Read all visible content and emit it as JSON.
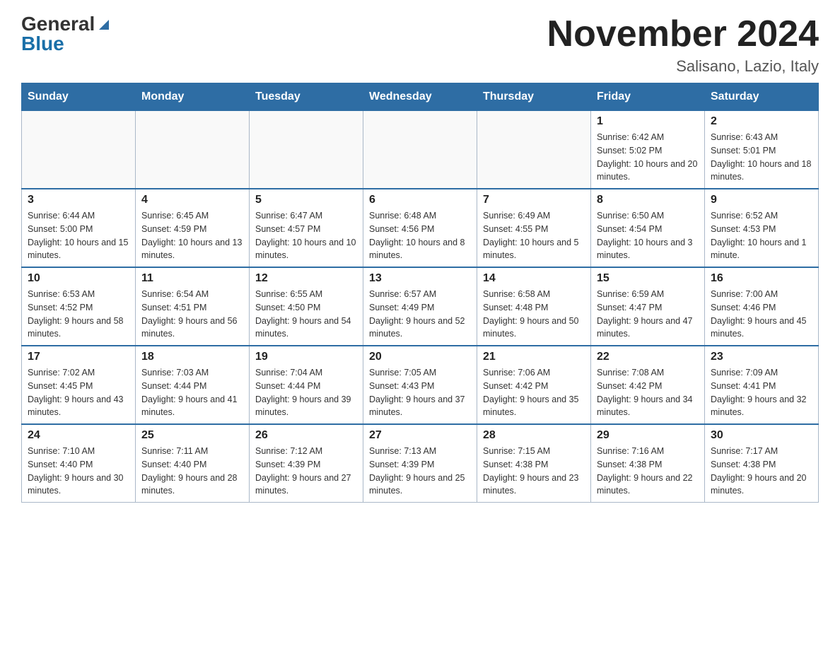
{
  "header": {
    "logo_general": "General",
    "logo_blue": "Blue",
    "month_title": "November 2024",
    "location": "Salisano, Lazio, Italy"
  },
  "days_of_week": [
    "Sunday",
    "Monday",
    "Tuesday",
    "Wednesday",
    "Thursday",
    "Friday",
    "Saturday"
  ],
  "weeks": [
    [
      {
        "day": "",
        "info": ""
      },
      {
        "day": "",
        "info": ""
      },
      {
        "day": "",
        "info": ""
      },
      {
        "day": "",
        "info": ""
      },
      {
        "day": "",
        "info": ""
      },
      {
        "day": "1",
        "info": "Sunrise: 6:42 AM\nSunset: 5:02 PM\nDaylight: 10 hours and 20 minutes."
      },
      {
        "day": "2",
        "info": "Sunrise: 6:43 AM\nSunset: 5:01 PM\nDaylight: 10 hours and 18 minutes."
      }
    ],
    [
      {
        "day": "3",
        "info": "Sunrise: 6:44 AM\nSunset: 5:00 PM\nDaylight: 10 hours and 15 minutes."
      },
      {
        "day": "4",
        "info": "Sunrise: 6:45 AM\nSunset: 4:59 PM\nDaylight: 10 hours and 13 minutes."
      },
      {
        "day": "5",
        "info": "Sunrise: 6:47 AM\nSunset: 4:57 PM\nDaylight: 10 hours and 10 minutes."
      },
      {
        "day": "6",
        "info": "Sunrise: 6:48 AM\nSunset: 4:56 PM\nDaylight: 10 hours and 8 minutes."
      },
      {
        "day": "7",
        "info": "Sunrise: 6:49 AM\nSunset: 4:55 PM\nDaylight: 10 hours and 5 minutes."
      },
      {
        "day": "8",
        "info": "Sunrise: 6:50 AM\nSunset: 4:54 PM\nDaylight: 10 hours and 3 minutes."
      },
      {
        "day": "9",
        "info": "Sunrise: 6:52 AM\nSunset: 4:53 PM\nDaylight: 10 hours and 1 minute."
      }
    ],
    [
      {
        "day": "10",
        "info": "Sunrise: 6:53 AM\nSunset: 4:52 PM\nDaylight: 9 hours and 58 minutes."
      },
      {
        "day": "11",
        "info": "Sunrise: 6:54 AM\nSunset: 4:51 PM\nDaylight: 9 hours and 56 minutes."
      },
      {
        "day": "12",
        "info": "Sunrise: 6:55 AM\nSunset: 4:50 PM\nDaylight: 9 hours and 54 minutes."
      },
      {
        "day": "13",
        "info": "Sunrise: 6:57 AM\nSunset: 4:49 PM\nDaylight: 9 hours and 52 minutes."
      },
      {
        "day": "14",
        "info": "Sunrise: 6:58 AM\nSunset: 4:48 PM\nDaylight: 9 hours and 50 minutes."
      },
      {
        "day": "15",
        "info": "Sunrise: 6:59 AM\nSunset: 4:47 PM\nDaylight: 9 hours and 47 minutes."
      },
      {
        "day": "16",
        "info": "Sunrise: 7:00 AM\nSunset: 4:46 PM\nDaylight: 9 hours and 45 minutes."
      }
    ],
    [
      {
        "day": "17",
        "info": "Sunrise: 7:02 AM\nSunset: 4:45 PM\nDaylight: 9 hours and 43 minutes."
      },
      {
        "day": "18",
        "info": "Sunrise: 7:03 AM\nSunset: 4:44 PM\nDaylight: 9 hours and 41 minutes."
      },
      {
        "day": "19",
        "info": "Sunrise: 7:04 AM\nSunset: 4:44 PM\nDaylight: 9 hours and 39 minutes."
      },
      {
        "day": "20",
        "info": "Sunrise: 7:05 AM\nSunset: 4:43 PM\nDaylight: 9 hours and 37 minutes."
      },
      {
        "day": "21",
        "info": "Sunrise: 7:06 AM\nSunset: 4:42 PM\nDaylight: 9 hours and 35 minutes."
      },
      {
        "day": "22",
        "info": "Sunrise: 7:08 AM\nSunset: 4:42 PM\nDaylight: 9 hours and 34 minutes."
      },
      {
        "day": "23",
        "info": "Sunrise: 7:09 AM\nSunset: 4:41 PM\nDaylight: 9 hours and 32 minutes."
      }
    ],
    [
      {
        "day": "24",
        "info": "Sunrise: 7:10 AM\nSunset: 4:40 PM\nDaylight: 9 hours and 30 minutes."
      },
      {
        "day": "25",
        "info": "Sunrise: 7:11 AM\nSunset: 4:40 PM\nDaylight: 9 hours and 28 minutes."
      },
      {
        "day": "26",
        "info": "Sunrise: 7:12 AM\nSunset: 4:39 PM\nDaylight: 9 hours and 27 minutes."
      },
      {
        "day": "27",
        "info": "Sunrise: 7:13 AM\nSunset: 4:39 PM\nDaylight: 9 hours and 25 minutes."
      },
      {
        "day": "28",
        "info": "Sunrise: 7:15 AM\nSunset: 4:38 PM\nDaylight: 9 hours and 23 minutes."
      },
      {
        "day": "29",
        "info": "Sunrise: 7:16 AM\nSunset: 4:38 PM\nDaylight: 9 hours and 22 minutes."
      },
      {
        "day": "30",
        "info": "Sunrise: 7:17 AM\nSunset: 4:38 PM\nDaylight: 9 hours and 20 minutes."
      }
    ]
  ]
}
